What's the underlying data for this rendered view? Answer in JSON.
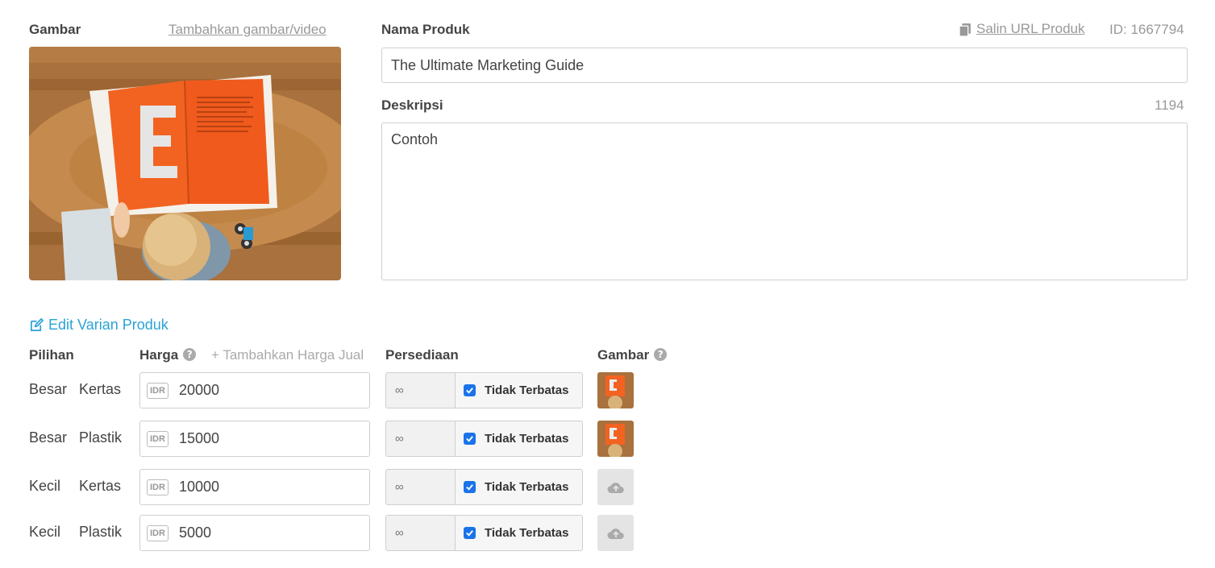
{
  "image_section": {
    "label": "Gambar",
    "add_link": "Tambahkan gambar/video"
  },
  "product": {
    "name_label": "Nama Produk",
    "copy_url": "Salin URL Produk",
    "id_text": "ID: 1667794",
    "name_value": "The Ultimate Marketing Guide",
    "desc_label": "Deskripsi",
    "desc_count": "1194",
    "desc_value": "Contoh"
  },
  "variants": {
    "edit_link": "Edit Varian Produk",
    "headers": {
      "options": "Pilihan",
      "price": "Harga",
      "add_sell_price": "+ Tambahkan Harga Jual",
      "stock": "Persediaan",
      "image": "Gambar"
    },
    "rows": [
      {
        "size": "Besar",
        "material": "Kertas",
        "currency": "IDR",
        "price": "20000",
        "stock": "∞",
        "unlimited": "Tidak Terbatas",
        "image": "thumbnail"
      },
      {
        "size": "Besar",
        "material": "Plastik",
        "currency": "IDR",
        "price": "15000",
        "stock": "∞",
        "unlimited": "Tidak Terbatas",
        "image": "thumbnail"
      },
      {
        "size": "Kecil",
        "material": "Kertas",
        "currency": "IDR",
        "price": "10000",
        "stock": "∞",
        "unlimited": "Tidak Terbatas",
        "image": "upload-icon"
      },
      {
        "size": "Kecil",
        "material": "Plastik",
        "currency": "IDR",
        "price": "5000",
        "stock": "∞",
        "unlimited": "Tidak Terbatas",
        "image": "upload-icon"
      }
    ]
  },
  "colors": {
    "accent": "#29a3d6",
    "checkbox": "#1a73e8",
    "book_orange": "#f26322"
  },
  "icons": [
    "copy-icon",
    "edit-icon",
    "help-icon",
    "check-icon",
    "cloud-upload-icon"
  ]
}
